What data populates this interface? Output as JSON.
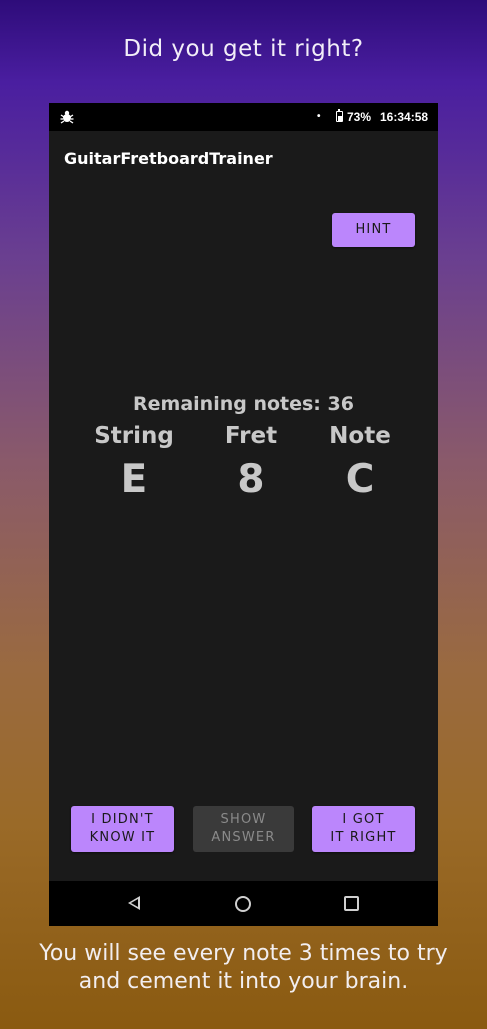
{
  "promo": {
    "title": "Did you get it right?",
    "caption": "You will see every note 3 times to try and cement it into your brain."
  },
  "status_bar": {
    "left_icon": "debug-bug-icon",
    "dot": "•",
    "battery_icon": "battery-icon",
    "battery": "73%",
    "time": "16:34:58"
  },
  "app_bar": {
    "title": "GuitarFretboardTrainer"
  },
  "buttons": {
    "hint": "HINT",
    "didnt_know": "I DIDN'T\nKNOW IT",
    "show_answer": "SHOW\nANSWER",
    "got_right": "I GOT\nIT RIGHT"
  },
  "quiz": {
    "remaining": "Remaining notes: 36",
    "columns": [
      {
        "header": "String",
        "value": "E"
      },
      {
        "header": "Fret",
        "value": "8"
      },
      {
        "header": "Note",
        "value": "C"
      }
    ]
  },
  "nav_bar": {
    "icons": [
      "back-icon",
      "home-icon",
      "recents-icon"
    ]
  },
  "colors": {
    "accent": "#bb86fc",
    "surface": "#1a1a1a",
    "disabled_button": "#3a3a3a"
  }
}
